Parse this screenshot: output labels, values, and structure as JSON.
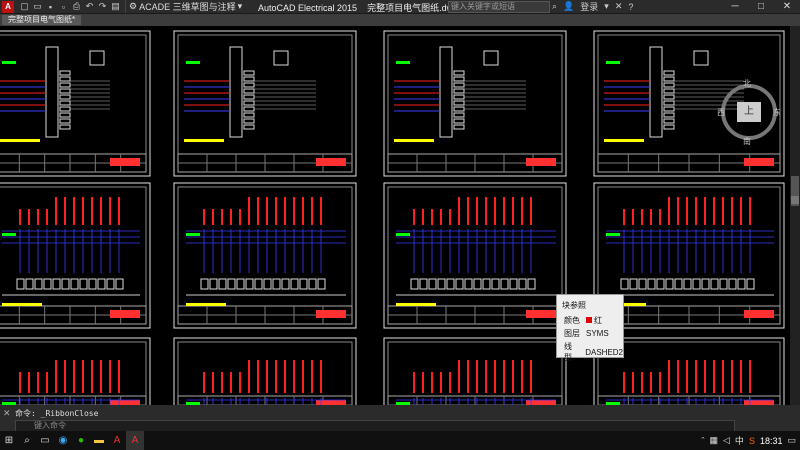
{
  "titlebar": {
    "logo": "A",
    "quick_access_icons": [
      "open-icon",
      "save-icon",
      "save-as-icon",
      "print-icon",
      "undo-icon",
      "redo-icon"
    ],
    "workspace": "ACADE 三维草图与注释",
    "app_name": "AutoCAD Electrical 2015",
    "file_name": "完整项目电气图纸.dwg",
    "search_placeholder": "键入关键字或短语",
    "login": "登录",
    "controls": {
      "minimize": "─",
      "maximize": "□",
      "close": "✕"
    }
  },
  "doc_tab": {
    "label": "完整项目电气图纸*"
  },
  "viewcube": {
    "top": "上",
    "north": "北",
    "south": "南",
    "west": "西",
    "east": "东"
  },
  "tooltip": {
    "title": "块参照",
    "rows": [
      {
        "label": "颜色",
        "value": "红",
        "swatch": "#dd0000"
      },
      {
        "label": "图层",
        "value": "SYMS"
      },
      {
        "label": "线型",
        "value": "DASHED2"
      }
    ]
  },
  "cmdline": {
    "history": "命令:  _RibbonClose",
    "placeholder": "键入命令"
  },
  "taskbar": {
    "time": "18:31",
    "ime": "中",
    "apps": [
      "windows-icon",
      "search-icon",
      "cortana-icon",
      "browser-icon",
      "wechat-icon",
      "explorer-icon",
      "autocad-icon",
      "autocad-active-icon"
    ]
  },
  "colors": {
    "wire_red": "#ff2020",
    "wire_blue": "#3b3bff",
    "frame": "#e0e0e0",
    "accent_yellow": "#ffff00",
    "accent_green": "#00ff00"
  }
}
